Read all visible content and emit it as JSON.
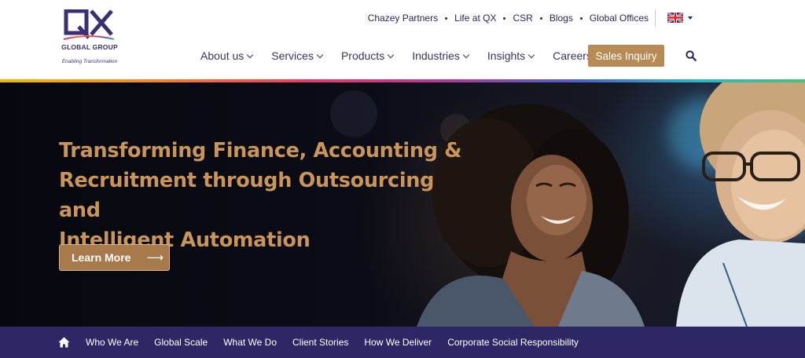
{
  "logo": {
    "mark": "QX",
    "group": "GLOBAL GROUP",
    "tagline": "Enabling Transformation"
  },
  "topnav": {
    "links": [
      "Chazey Partners",
      "Life at QX",
      "CSR",
      "Blogs",
      "Global Offices"
    ],
    "language_icon": "uk-flag-icon"
  },
  "mainnav": {
    "items": [
      {
        "label": "About us",
        "dropdown": true
      },
      {
        "label": "Services",
        "dropdown": true
      },
      {
        "label": "Products",
        "dropdown": true
      },
      {
        "label": "Industries",
        "dropdown": true
      },
      {
        "label": "Insights",
        "dropdown": true
      },
      {
        "label": "Careers",
        "dropdown": false
      }
    ],
    "cta": "Sales Inquiry",
    "search_icon": "search-icon"
  },
  "hero": {
    "title_lines": [
      "Transforming Finance, Accounting &",
      "Recruitment through Outsourcing and",
      "Intelligent Automation"
    ],
    "button": "Learn More",
    "button_icon": "arrow-right-icon"
  },
  "subnav": {
    "home_icon": "home-icon",
    "items": [
      "Who We Are",
      "Global Scale",
      "What We Do",
      "Client Stories",
      "How We Deliver",
      "Corporate Social Responsibility"
    ]
  },
  "colors": {
    "brand_navy": "#2d2766",
    "accent_gold": "#b88a55",
    "hero_title": "#c9955a"
  }
}
